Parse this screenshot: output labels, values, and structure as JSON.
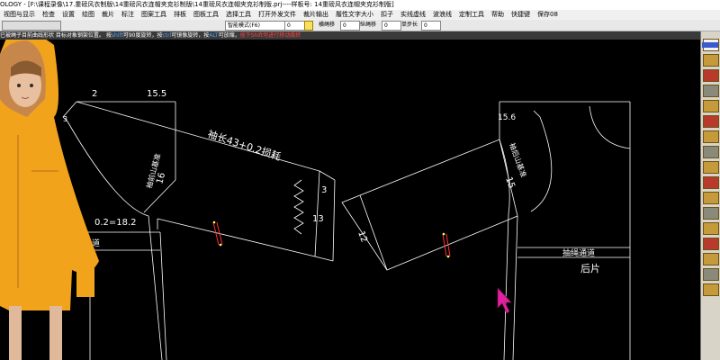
{
  "title_bar": {
    "text": "OLOGY - [F:\\课程录像\\17.重磅风衣制版\\14重磅风衣连帽夹克衫制版\\14重磅风衣连帽夹克衫制版.prj----样板号: 14重磅风衣连帽夹克衫制版]"
  },
  "menu": [
    "视图与显示",
    "检查",
    "设置",
    "绘图",
    "裁片",
    "标注",
    "图案工具",
    "排板",
    "图板工具",
    "选择工具",
    "打开外发文件",
    "裁片输出",
    "履性文字大小",
    "扣子",
    "实线虚线",
    "波浪线",
    "定制工具",
    "帮助",
    "快捷键",
    "保存08"
  ],
  "toolbar": {
    "mode_select": "智能模式(F6)",
    "field_value": "0",
    "label_horizontal": "横绳移",
    "label_vertical": "纵绳移",
    "label_step": "单步长",
    "val1": "0",
    "val2": "0",
    "val3": "0"
  },
  "status": {
    "seg1": "已被绳子目前曲线形状 目标对象钢架位置。",
    "seg2": "按",
    "seg3": "shift",
    "seg4": "可90度旋转，按",
    "seg5": "ctrl",
    "seg6": "可镜像旋转，按",
    "seg7": "ALT",
    "seg8": "可放缩，",
    "seg9": "按下Shift可进行移动跳转"
  },
  "pattern_labels": {
    "d_2": "2",
    "d_15_5": "15.5",
    "d_3": "3",
    "sleeve_length": "袖长43+0.2损耗",
    "front_armhole": "袖前山基准",
    "d_16": "16",
    "d_3b": "3",
    "d_13": "13",
    "d_18_2": "0.2=18.2",
    "d_quan": "道",
    "d_15_6": "15.6",
    "back_armhole": "袖后山基准",
    "d_15": "15",
    "d_12": "12",
    "drawstring": "抽绳通道",
    "back_piece": "后片"
  },
  "colors": {
    "line": "#ffffff",
    "notch": "#ff3030",
    "cursor": "#e020a0",
    "jacket": "#f2a31c"
  },
  "icons": [
    "cursor-icon",
    "tool-icon"
  ]
}
